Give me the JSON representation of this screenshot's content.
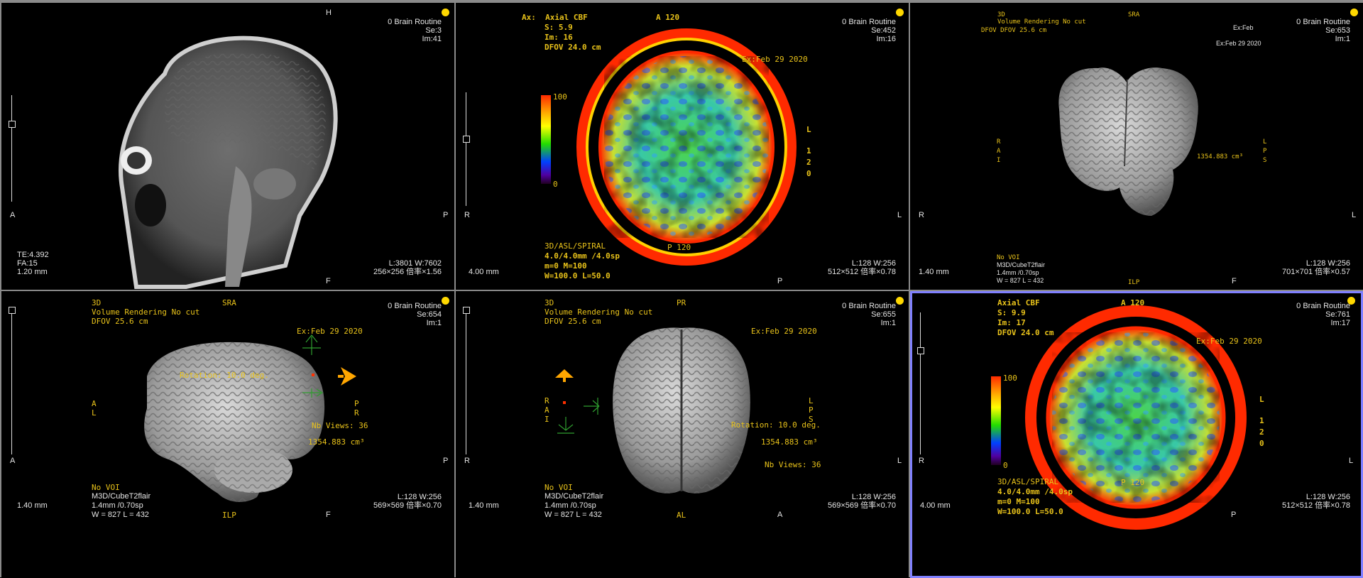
{
  "accent_colors": {
    "annotation": "#e8c21a",
    "active_border": "#8080ff",
    "marker": "#ffd800"
  },
  "viewports": [
    {
      "id": "vp1",
      "study": "0 Brain Routine",
      "series": "Se:3",
      "image": "Im:41",
      "orient_top": "H",
      "orient_left": "A",
      "orient_right": "P",
      "orient_bottom": "F",
      "params": [
        "TE:4.392",
        "FA:15",
        "1.20 mm"
      ],
      "wl": "L:3801 W:7602",
      "matrix": "256×256 倍率×1.56"
    },
    {
      "id": "vp2",
      "study": "0 Brain Routine",
      "series": "Se:452",
      "image": "Im:16",
      "orient_left": "R",
      "orient_right": "L",
      "orient_bottom": "P",
      "header": [
        "Ax:  Axial CBF",
        "S: 5.9",
        "Im: 16",
        "DFOV 24.0 cm"
      ],
      "header_mid": "A 120",
      "exam": "Ex:Feb 29 2020",
      "side_labels": [
        "L",
        "1",
        "2",
        "0"
      ],
      "scale_max": "100",
      "scale_min": "0",
      "inner_label": "P 120",
      "footer": [
        "3D/ASL/SPIRAL",
        "4.0/4.0mm /4.0sp",
        "m=0 M=100",
        "W=100.0 L=50.0"
      ],
      "thickness": "4.00 mm",
      "wl": "L:128 W:256",
      "matrix": "512×512 倍率×0.78"
    },
    {
      "id": "vp3",
      "study": "0 Brain Routine",
      "series": "Se:653",
      "image": "Im:1",
      "orient_left": "R",
      "orient_right": "L",
      "orient_bottom": "F",
      "header": [
        "3D",
        "Volume Rendering No cut",
        "DFOV DFOV 25.6 cm"
      ],
      "header_mid": "SRA",
      "exam_a": "Ex:Feb",
      "exam_b": "Ex:Feb 29 2020",
      "left_axis": [
        "R",
        "A",
        "I"
      ],
      "right_axis": [
        "L",
        "P",
        "S"
      ],
      "volume": "1354.883 cm³",
      "footer": [
        "No VOI",
        "M3D/CubeT2flair",
        "1.4mm /0.70sp",
        "W = 827 L = 432"
      ],
      "bottom_mid": "ILP",
      "thickness": "1.40 mm",
      "wl": "L:128 W:256",
      "matrix": "701×701 倍率×0.57"
    },
    {
      "id": "vp4",
      "study": "0 Brain Routine",
      "series": "Se:654",
      "image": "Im:1",
      "orient_left": "A",
      "orient_right": "P",
      "orient_bottom": "F",
      "header": [
        "3D",
        "Volume Rendering No cut",
        "DFOV 25.6 cm"
      ],
      "header_mid": "SRA",
      "exam": "Ex:Feb 29 2020",
      "left_axis": [
        "A",
        "L"
      ],
      "right_axis": [
        "P",
        "R"
      ],
      "rotation": "Rotation: 10.0 deg.",
      "views": "Nb Views: 36",
      "volume": "1354.883 cm³",
      "footer": [
        "No VOI",
        "M3D/CubeT2flair",
        "1.4mm /0.70sp",
        "W = 827 L = 432"
      ],
      "bottom_mid": "ILP",
      "thickness": "1.40 mm",
      "wl": "L:128 W:256",
      "matrix": "569×569 倍率×0.70"
    },
    {
      "id": "vp5",
      "study": "0 Brain Routine",
      "series": "Se:655",
      "image": "Im:1",
      "orient_left": "R",
      "orient_right": "L",
      "orient_bottom": "A",
      "header": [
        "3D",
        "Volume Rendering No cut",
        "DFOV 25.6 cm"
      ],
      "header_mid": "PR",
      "exam": "Ex:Feb 29 2020",
      "left_axis": [
        "R",
        "A",
        "I"
      ],
      "right_axis": [
        "L",
        "P",
        "S"
      ],
      "rotation": "Rotation: 10.0 deg.",
      "views": "Nb Views: 36",
      "volume": "1354.883 cm³",
      "footer": [
        "No VOI",
        "M3D/CubeT2flair",
        "1.4mm /0.70sp",
        "W = 827 L = 432"
      ],
      "bottom_mid": "AL",
      "thickness": "1.40 mm",
      "wl": "L:128 W:256",
      "matrix": "569×569 倍率×0.70"
    },
    {
      "id": "vp6",
      "study": "0 Brain Routine",
      "series": "Se:761",
      "image": "Im:17",
      "orient_left": "R",
      "orient_right": "L",
      "orient_bottom": "P",
      "header": [
        "Axial CBF",
        "S: 9.9",
        "Im: 17",
        "DFOV 24.0 cm"
      ],
      "header_mid": "A 120",
      "exam": "Ex:Feb 29 2020",
      "side_labels": [
        "L",
        "1",
        "2",
        "0"
      ],
      "scale_max": "100",
      "scale_min": "0",
      "inner_label": "P 120",
      "footer": [
        "3D/ASL/SPIRAL",
        "4.0/4.0mm /4.0sp",
        "m=0 M=100",
        "W=100.0 L=50.0"
      ],
      "thickness": "4.00 mm",
      "wl": "L:128 W:256",
      "matrix": "512×512 倍率×0.78"
    }
  ]
}
